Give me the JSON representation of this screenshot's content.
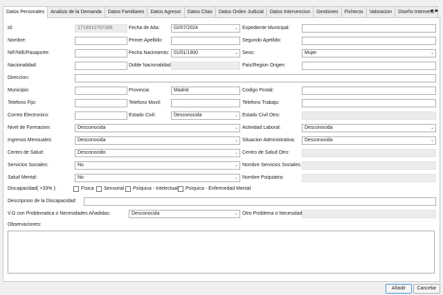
{
  "tabs": [
    "Datos Personales",
    "Analisis de la Demanda",
    "Datos Familiares",
    "Datos Agresor",
    "Datos Citas",
    "Datos Orden Judicial",
    "Datos Intervencion",
    "Gestiones",
    "Ficheros",
    "Valoracion",
    "Diseño Intervenc"
  ],
  "tab_scroll": {
    "left": "◀",
    "right": "▶"
  },
  "labels": {
    "id": "Id:",
    "fecha_alta": "Fecha de Alta:",
    "expediente": "Expediente Municipal:",
    "nombre": "Nombre:",
    "primer_apellido": "Primer Apellido:",
    "segundo_apellido": "Segundo Apellido:",
    "nif": "NIF/NIE/Pasaporte:",
    "fecha_nac": "Fecha Nacimiento:",
    "sexo": "Sexo:",
    "nacionalidad": "Nacionalidad:",
    "doble_nac": "Doble Nacionalidad:",
    "pais": "Pais/Region Origen:",
    "direccion": "Direccion:",
    "municipio": "Municipio:",
    "provincia": "Provincia:",
    "cp": "Codigo Postal:",
    "tel_fijo": "Telefono Fijo:",
    "tel_movil": "Telefono Movil:",
    "tel_trabajo": "Telefono Trabajo:",
    "correo": "Correo Electronico:",
    "estado_civil": "Estado Civil:",
    "estado_civil_otro": "Estado Civil Otro:",
    "formacion": "Nivel de Formacion:",
    "actividad": "Actividad Laboral:",
    "ingresos": "Ingresos Mensuales:",
    "situacion": "Situacion Administrativa:",
    "centro_salud": "Centro de Salud:",
    "centro_salud_otro": "Centro de Salud Otro:",
    "servicios": "Servicios Sociales:",
    "nombre_servicios": "Nombre Servicios Sociales:",
    "salud_mental": "Salud Mental:",
    "nombre_psiquiatra": "Nombre Psiquiatra:",
    "discapacidad": "Discapacidad( >33% ):",
    "descripcion_disc": "Descripcion de la Discapacidad:",
    "vg": "V.G con Problematica o Necesidades Añadidas:",
    "otro_problema": "Otro Problema o Necesidad:",
    "observaciones": "Observaciones:"
  },
  "values": {
    "id": "1719910787399",
    "fecha_alta": "02/07/2024",
    "fecha_nac": "01/01/1900",
    "sexo": "Mujer",
    "provincia": "Madrid",
    "estado_civil": "Desconocida",
    "formacion": "Desconocida",
    "actividad": "Desconocida",
    "ingresos": "Desconocida",
    "situacion": "Desconocida",
    "centro_salud": "Desconocido",
    "servicios": "No",
    "salud_mental": "No",
    "vg": "Desconocida"
  },
  "discapacidad_options": [
    "Física",
    "Sensorial",
    "Psíquica - Intelectual",
    "Psíquica - Enfermedad Mental"
  ],
  "buttons": {
    "add": "Añadir",
    "cancel": "Cancelar"
  },
  "chevron": "⌄"
}
